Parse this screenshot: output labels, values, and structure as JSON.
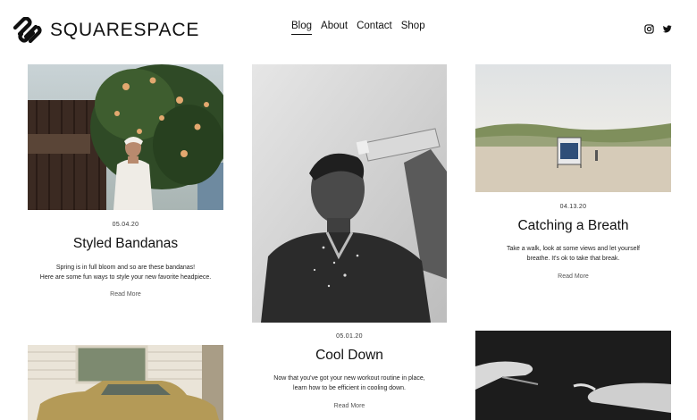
{
  "brand": {
    "name": "SQUARESPACE"
  },
  "nav": {
    "items": [
      "Blog",
      "About",
      "Contact",
      "Shop"
    ],
    "active": "Blog"
  },
  "social": {
    "icons": [
      "instagram-icon",
      "twitter-icon"
    ]
  },
  "posts": [
    {
      "date": "05.04.20",
      "title": "Styled Bandanas",
      "excerpt_line1": "Spring is in full bloom and so are these bandanas!",
      "excerpt_line2": "Here are some fun ways to style your new favorite headpiece.",
      "more": "Read More"
    },
    {
      "date": "05.01.20",
      "title": "Cool Down",
      "excerpt_line1": "Now that you've got your new workout routine in place,",
      "excerpt_line2": "learn how to be efficient in cooling down.",
      "more": "Read More"
    },
    {
      "date": "04.13.20",
      "title": "Catching a Breath",
      "excerpt_line1": "Take a walk, look at some views and let yourself",
      "excerpt_line2": "breathe. It's ok to take that break.",
      "more": "Read More"
    }
  ]
}
